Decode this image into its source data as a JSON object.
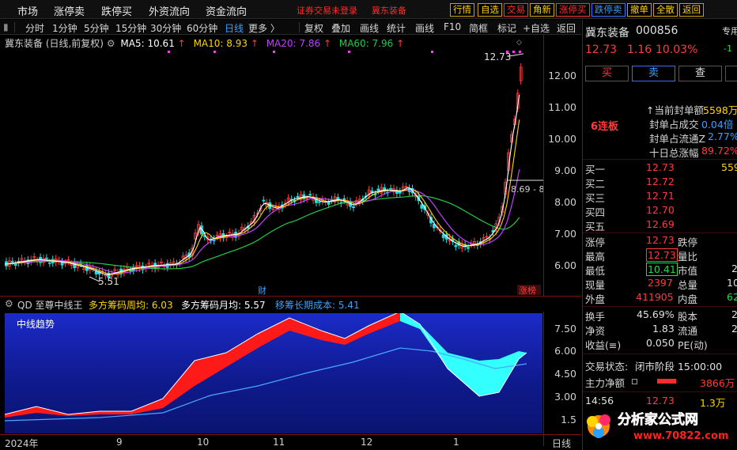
{
  "menu": {
    "items": [
      "市场",
      "涨停卖",
      "跌停买",
      "外资流向",
      "资金流向"
    ],
    "warning1": "证券交易未登录",
    "warning2": "冀东装备"
  },
  "toolbar": {
    "b1": "行情",
    "b2": "自选",
    "b3": "交易",
    "b4": "角新",
    "b5": "涨停买",
    "b6": "跌停卖",
    "b7": "撤单",
    "b8": "全散",
    "b9": "返回"
  },
  "periods": [
    "分时",
    "1分钟",
    "5分钟",
    "15分钟",
    "30分钟",
    "60分钟",
    "日线",
    "更多 〉"
  ],
  "tools": [
    "复权",
    "叠加",
    "画线",
    "统计",
    "画线",
    "F10",
    "简框",
    "标记",
    "+自选",
    "返回"
  ],
  "legend": {
    "title": "冀东装备 (日线,前复权)",
    "ma5": "MA5: 10.61",
    "ma10": "MA10: 8.93",
    "ma20": "MA20: 7.86",
    "ma60": "MA60: 7.96",
    "arrow": "↑"
  },
  "annotations": {
    "high": "12.73",
    "low": "5.51",
    "cross": "8.69 - 8",
    "cai": "财",
    "zb": "涨榜"
  },
  "yaxis": {
    "main": [
      "12.00",
      "11.00",
      "10.00",
      "9.00",
      "8.00",
      "7.00",
      "6.00"
    ],
    "sub": [
      "7.50",
      "6.00",
      "4.50",
      "3.00",
      "1.5"
    ]
  },
  "indicator": {
    "name": "QD 至尊中线王",
    "v1": "多方筹码周均: 6.03",
    "v2": "多方筹码月均: 5.57",
    "v3": "移筹长期成本: 5.41",
    "panel_label": "中线趋势"
  },
  "xaxis": {
    "labels": [
      "2024年",
      "9",
      "10",
      "11",
      "12",
      "1"
    ],
    "period": "日线"
  },
  "stock": {
    "name": "冀东装备",
    "code": "000856",
    "tab": "专用",
    "price": "12.73",
    "change": "1.16",
    "pct": "10.03%",
    "buy": "买",
    "sell": "卖",
    "query": "查",
    "side": "-1"
  },
  "limit": {
    "streak": "6连板",
    "rows": [
      [
        "↑当前封单额",
        "5598万"
      ],
      [
        "封单占成交",
        "0.04倍"
      ],
      [
        "封单占流通Z",
        "2.77%"
      ],
      [
        "十日总涨幅",
        "89.72%"
      ]
    ]
  },
  "book": [
    [
      "买一",
      "12.73",
      "559"
    ],
    [
      "买二",
      "12.72",
      ""
    ],
    [
      "买三",
      "12.71",
      ""
    ],
    [
      "买四",
      "12.70",
      ""
    ],
    [
      "买五",
      "12.69",
      ""
    ]
  ],
  "quote": [
    [
      "涨停",
      "12.73",
      "跌停",
      ""
    ],
    [
      "最高",
      "12.73",
      "量比",
      ""
    ],
    [
      "最低",
      "10.41",
      "市值",
      "2"
    ],
    [
      "现量",
      "2397",
      "总量",
      "10"
    ],
    [
      "外盘",
      "411905",
      "内盘",
      "62"
    ]
  ],
  "stats": [
    [
      "换手",
      "45.69%",
      "股本",
      "2"
    ],
    [
      "净资",
      "1.83",
      "流通",
      "2"
    ],
    [
      "收益(≡)",
      "0.050",
      "PE(动)",
      ""
    ]
  ],
  "state": {
    "label": "交易状态:",
    "value": "闭市阶段 15:00:00"
  },
  "flow": {
    "label": "主力净额",
    "value": "3866万"
  },
  "tick": {
    "time": "14:56",
    "price": "12.73",
    "vol": "1.3万"
  },
  "watermark": {
    "title": "分析家公式网",
    "url": "www.70822.com"
  },
  "colors": {
    "up": "#ff3b3b",
    "down": "#22dddd",
    "ma5": "#ffffff",
    "ma10": "#ffd400",
    "ma20": "#c040ff",
    "ma60": "#22cc44",
    "accent": "#3aa0ff"
  }
}
